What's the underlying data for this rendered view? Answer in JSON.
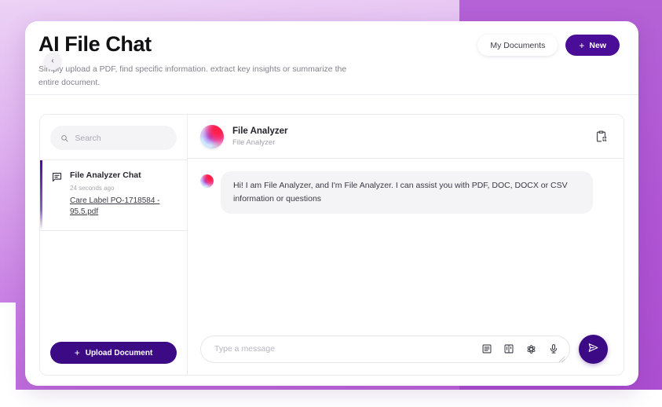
{
  "theme": {
    "brand_purple": "#4a0d97",
    "button_purple": "#3d0a85",
    "bg_gradient_light": "#e9c9f2",
    "bg_gradient_dark": "#b055d4",
    "panel_grey": "#f4f3f6",
    "text_dark": "#1f1f27",
    "text_muted": "#a2a2ad"
  },
  "header": {
    "title": "AI File Chat",
    "subtitle": "Simply upload a PDF, find specific information. extract key insights or summarize the entire document.",
    "collapse_icon": "chevron-left-icon",
    "my_documents_label": "My Documents",
    "new_label": "New",
    "new_icon": "plus-icon"
  },
  "sidebar": {
    "search": {
      "placeholder": "Search",
      "value": "",
      "icon": "search-icon"
    },
    "chats": [
      {
        "icon": "chat-bubble-icon",
        "title": "File Analyzer Chat",
        "time": "24 seconds ago",
        "file": "Care Label PO-1718584 - 95.5.pdf",
        "active": true
      }
    ],
    "upload": {
      "label": "Upload Document",
      "icon": "plus-icon"
    }
  },
  "chat": {
    "header": {
      "avatar": "gradient-orb-avatar",
      "name": "File Analyzer",
      "subtitle": "File Analyzer",
      "copy_icon": "clipboard-copy-icon"
    },
    "messages": [
      {
        "avatar": "gradient-orb-avatar",
        "role": "assistant",
        "text": "Hi! I am File Analyzer, and I'm File Analyzer. I can assist you with PDF, DOC, DOCX or CSV information or questions"
      }
    ],
    "composer": {
      "placeholder": "Type a message",
      "value": "",
      "tools": [
        {
          "icon": "document-lines-icon",
          "name": "document-tool"
        },
        {
          "icon": "kanban-board-icon",
          "name": "board-tool"
        },
        {
          "icon": "openai-flower-icon",
          "name": "ai-model-tool"
        },
        {
          "icon": "microphone-icon",
          "name": "voice-tool"
        }
      ],
      "send_icon": "send-paper-plane-icon"
    }
  }
}
